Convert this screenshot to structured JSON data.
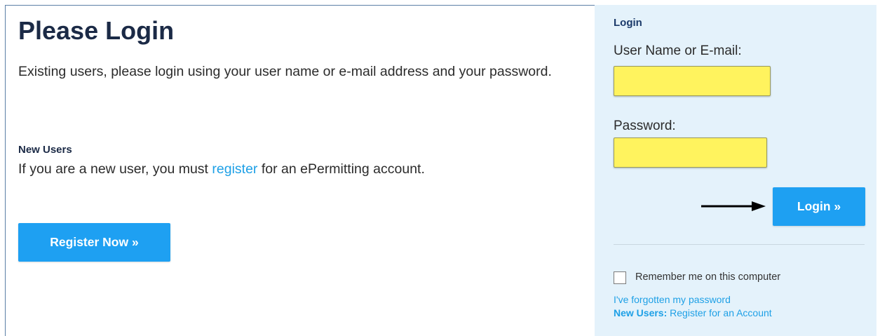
{
  "main": {
    "title": "Please Login",
    "intro": "Existing users, please login using your user name or e-mail address and your password.",
    "new_users_heading": "New Users",
    "new_users_text_before": "If you are a new user, you must ",
    "new_users_link": "register",
    "new_users_text_after": " for an ePermitting account.",
    "register_button": "Register Now »"
  },
  "sidebar": {
    "heading": "Login",
    "username_label": "User Name or E-mail:",
    "username_value": "",
    "password_label": "Password:",
    "password_value": "",
    "login_button": "Login »",
    "remember_label": "Remember me on this computer",
    "remember_checked": false,
    "forgot_link": "I've forgotten my password",
    "register_prefix": "New Users:",
    "register_link": " Register for an Account"
  },
  "colors": {
    "accent": "#1ea0f2",
    "link": "#1ea0e6",
    "input_highlight": "#fff35e",
    "sidebar_bg": "#e4f2fb",
    "heading": "#1b2a46"
  },
  "annotation": {
    "arrow": "arrow-right-icon"
  }
}
